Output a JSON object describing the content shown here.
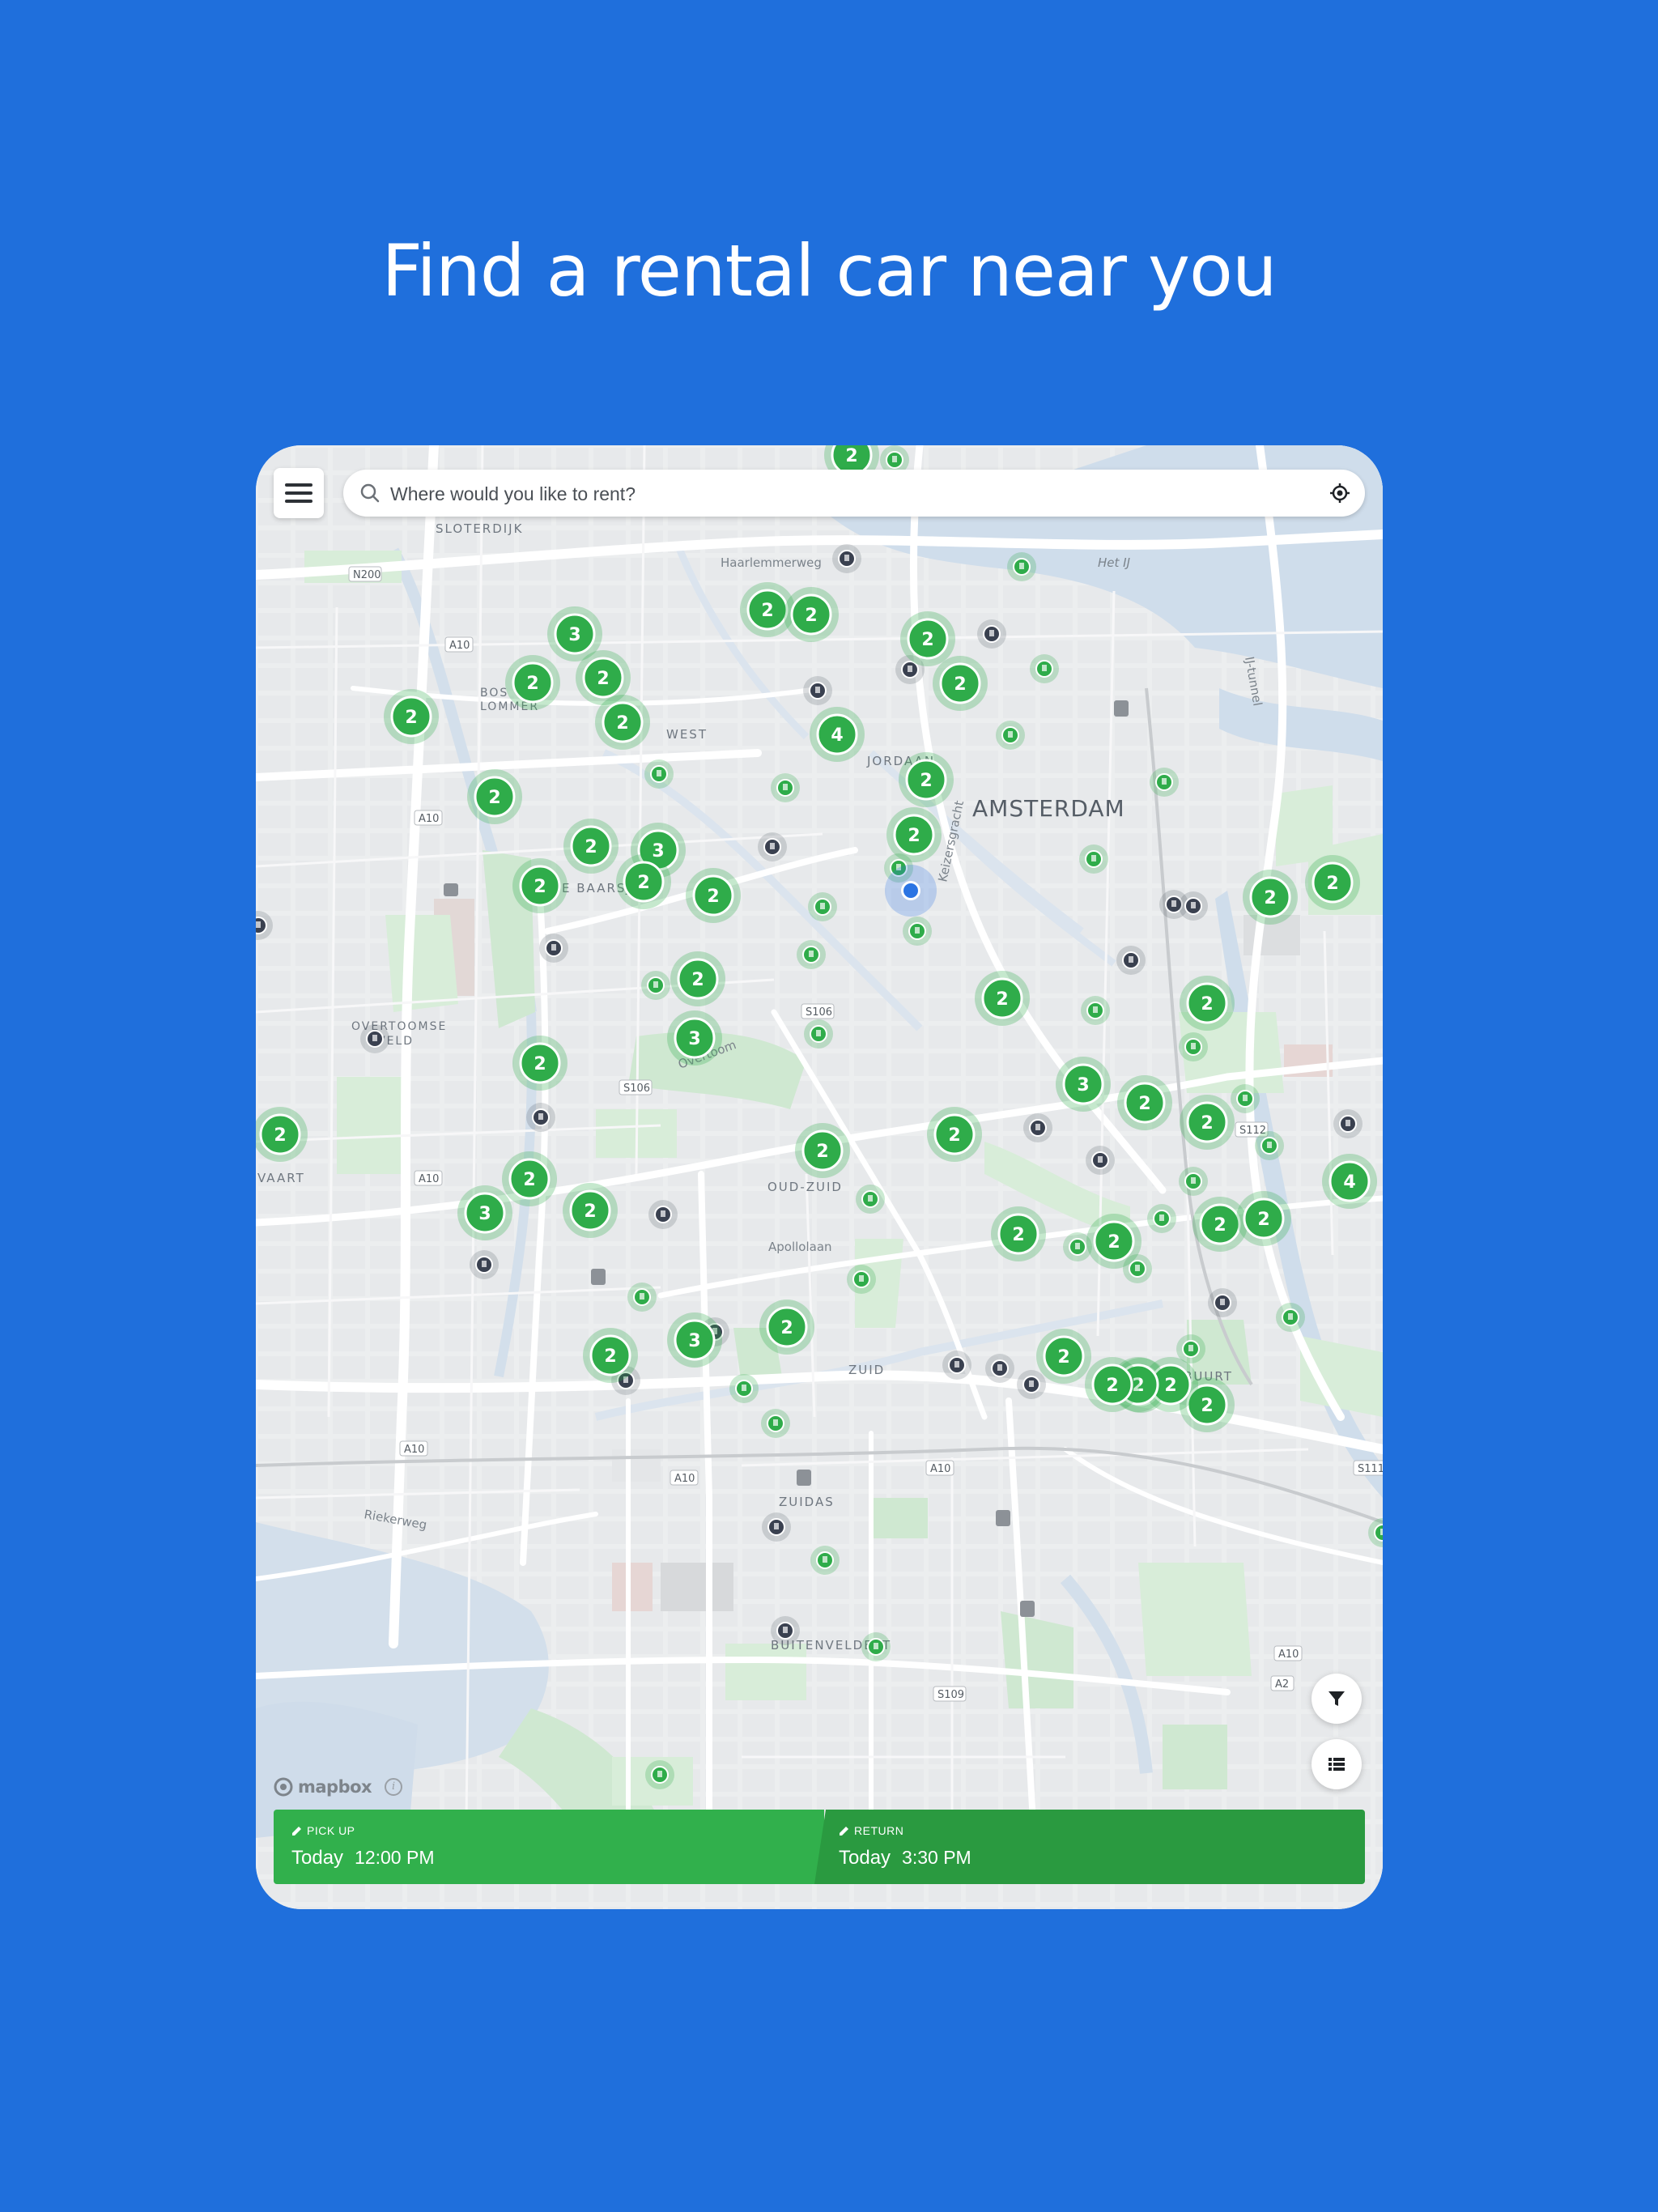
{
  "headline": "Find a rental car near you",
  "search": {
    "placeholder": "Where would you like to rent?"
  },
  "map": {
    "city_label": "AMSTERDAM",
    "district_labels": [
      "SLOTERDIJK",
      "BOS EN LOMMER",
      "WEST",
      "JORDAAN",
      "DE BAARSJES",
      "OVERTOOMSE VELD",
      "VAART",
      "OUD-ZUID",
      "ZUID",
      "ZUIDAS",
      "BUITENVELDERT",
      "RIVIERENBUURT"
    ],
    "road_labels": [
      "Haarlemmerweg",
      "Het IJ",
      "IJ-tunnel",
      "Keizersgracht",
      "Overtoom",
      "Apollolaan",
      "Riekerweg"
    ],
    "road_shields": [
      "N200",
      "A10",
      "A10",
      "A10",
      "S106",
      "S106",
      "A10",
      "A10",
      "A10",
      "A10",
      "S109",
      "A2",
      "S112",
      "S111"
    ],
    "cluster_counts": [
      "2",
      "3",
      "2",
      "2",
      "2",
      "2",
      "2",
      "2",
      "2",
      "2",
      "4",
      "2",
      "2",
      "2",
      "2",
      "3",
      "2",
      "2",
      "2",
      "2",
      "2",
      "2",
      "2",
      "2",
      "3",
      "2",
      "3",
      "2",
      "2",
      "2",
      "2",
      "2",
      "2",
      "3",
      "2",
      "4",
      "2",
      "2",
      "2",
      "2",
      "2",
      "2",
      "2",
      "2",
      "2",
      "2",
      "2",
      "3",
      "2"
    ],
    "accent_color": "#2fac4a",
    "user_location_color": "#2b74e3"
  },
  "attribution": {
    "logo_text": "mapbox"
  },
  "booking_bar": {
    "pickup_label": "PICK UP",
    "pickup_day": "Today",
    "pickup_time": "12:00 PM",
    "return_label": "RETURN",
    "return_day": "Today",
    "return_time": "3:30 PM"
  },
  "icons": [
    "menu-icon",
    "search-icon",
    "locate-icon",
    "filter-icon",
    "list-icon",
    "pencil-icon",
    "info-icon"
  ]
}
